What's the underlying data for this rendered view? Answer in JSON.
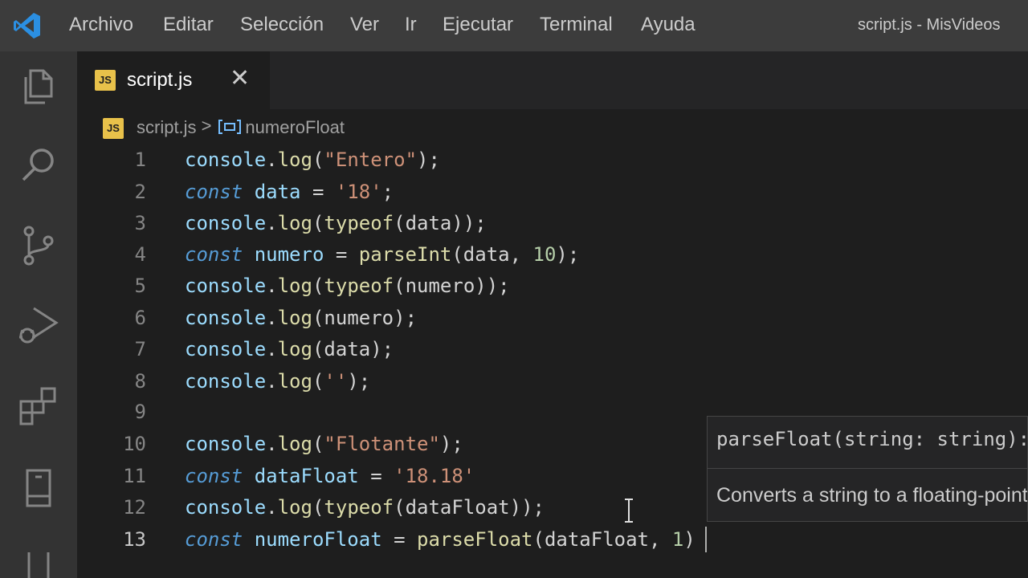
{
  "app": {
    "window_title": "script.js - MisVideos",
    "accent": "#2b8fe2"
  },
  "menu": [
    "Archivo",
    "Editar",
    "Selección",
    "Ver",
    "Ir",
    "Ejecutar",
    "Terminal",
    "Ayuda"
  ],
  "activity_icons": [
    "explorer-icon",
    "search-icon",
    "source-control-icon",
    "run-debug-icon",
    "extensions-icon",
    "remote-explorer-icon",
    "testing-icon"
  ],
  "tab": {
    "label": "script.js",
    "badge": "JS",
    "close": "✕"
  },
  "breadcrumb": {
    "file": "script.js",
    "separator": ">",
    "symbol": "numeroFloat"
  },
  "editor": {
    "lines": [
      {
        "n": "1",
        "tokens": [
          [
            "console",
            "var"
          ],
          [
            ".",
            "op"
          ],
          [
            "log",
            "fn"
          ],
          [
            "(",
            "op"
          ],
          [
            "\"Entero\"",
            "str"
          ],
          [
            ");",
            "op"
          ]
        ]
      },
      {
        "n": "2",
        "tokens": [
          [
            "const",
            "kw"
          ],
          [
            " data ",
            "var"
          ],
          [
            "=",
            "op"
          ],
          [
            " ",
            "op"
          ],
          [
            "'18'",
            "str"
          ],
          [
            ";",
            "op"
          ]
        ]
      },
      {
        "n": "3",
        "tokens": [
          [
            "console",
            "var"
          ],
          [
            ".",
            "op"
          ],
          [
            "log",
            "fn"
          ],
          [
            "(",
            "op"
          ],
          [
            "typeof",
            "fn"
          ],
          [
            "(data));",
            "op"
          ]
        ]
      },
      {
        "n": "4",
        "tokens": [
          [
            "const",
            "kw"
          ],
          [
            " numero ",
            "var"
          ],
          [
            "=",
            "op"
          ],
          [
            " ",
            "op"
          ],
          [
            "parseInt",
            "fn"
          ],
          [
            "(data, ",
            "op"
          ],
          [
            "10",
            "num"
          ],
          [
            ");",
            "op"
          ]
        ]
      },
      {
        "n": "5",
        "tokens": [
          [
            "console",
            "var"
          ],
          [
            ".",
            "op"
          ],
          [
            "log",
            "fn"
          ],
          [
            "(",
            "op"
          ],
          [
            "typeof",
            "fn"
          ],
          [
            "(numero));",
            "op"
          ]
        ]
      },
      {
        "n": "6",
        "tokens": [
          [
            "console",
            "var"
          ],
          [
            ".",
            "op"
          ],
          [
            "log",
            "fn"
          ],
          [
            "(numero);",
            "op"
          ]
        ]
      },
      {
        "n": "7",
        "tokens": [
          [
            "console",
            "var"
          ],
          [
            ".",
            "op"
          ],
          [
            "log",
            "fn"
          ],
          [
            "(data);",
            "op"
          ]
        ]
      },
      {
        "n": "8",
        "tokens": [
          [
            "console",
            "var"
          ],
          [
            ".",
            "op"
          ],
          [
            "log",
            "fn"
          ],
          [
            "(",
            "op"
          ],
          [
            "''",
            "str"
          ],
          [
            ");",
            "op"
          ]
        ]
      },
      {
        "n": "9",
        "tokens": []
      },
      {
        "n": "10",
        "tokens": [
          [
            "console",
            "var"
          ],
          [
            ".",
            "op"
          ],
          [
            "log",
            "fn"
          ],
          [
            "(",
            "op"
          ],
          [
            "\"Flotante\"",
            "str"
          ],
          [
            ");",
            "op"
          ]
        ]
      },
      {
        "n": "11",
        "tokens": [
          [
            "const",
            "kw"
          ],
          [
            " dataFloat ",
            "var"
          ],
          [
            "=",
            "op"
          ],
          [
            " ",
            "op"
          ],
          [
            "'18.18'",
            "str"
          ]
        ]
      },
      {
        "n": "12",
        "tokens": [
          [
            "console",
            "var"
          ],
          [
            ".",
            "op"
          ],
          [
            "log",
            "fn"
          ],
          [
            "(",
            "op"
          ],
          [
            "typeof",
            "fn"
          ],
          [
            "(dataFloat));",
            "op"
          ]
        ]
      },
      {
        "n": "13",
        "tokens": [
          [
            "const",
            "kw"
          ],
          [
            " numeroFloat ",
            "var"
          ],
          [
            "=",
            "op"
          ],
          [
            " ",
            "op"
          ],
          [
            "parseFloat",
            "fn"
          ],
          [
            "(dataFloat, ",
            "op"
          ],
          [
            "1",
            "num"
          ],
          [
            ")",
            "op"
          ]
        ]
      }
    ],
    "current_line": "13"
  },
  "hover": {
    "signature": "parseFloat(string: string): number",
    "doc": "Converts a string to a floating-point number."
  }
}
